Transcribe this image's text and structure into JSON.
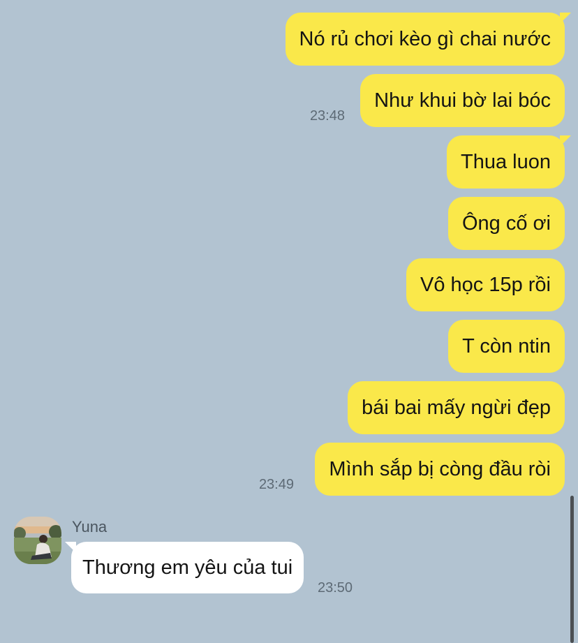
{
  "colors": {
    "background": "#b2c3d1",
    "outgoing_bubble": "#fae84a",
    "incoming_bubble": "#ffffff",
    "timestamp": "#5d6a75"
  },
  "messages": {
    "m0": {
      "text": "Nó rủ chơi kèo gì chai nước"
    },
    "m1": {
      "text": "Như khui bờ lai bóc",
      "time": "23:48"
    },
    "m2": {
      "text": "Thua luon"
    },
    "m3": {
      "text": "Ông cố ơi"
    },
    "m4": {
      "text": "Vô học 15p rồi"
    },
    "m5": {
      "text": "T còn ntin"
    },
    "m6": {
      "text": "bái bai mấy ngừi đẹp"
    },
    "m7": {
      "text": "Mình sắp bị còng đầu ròi",
      "time": "23:49"
    }
  },
  "incoming": {
    "sender_name": "Yuna",
    "avatar_icon": "user-photo-avatar",
    "text": "Thương em yêu của tui",
    "time": "23:50"
  }
}
